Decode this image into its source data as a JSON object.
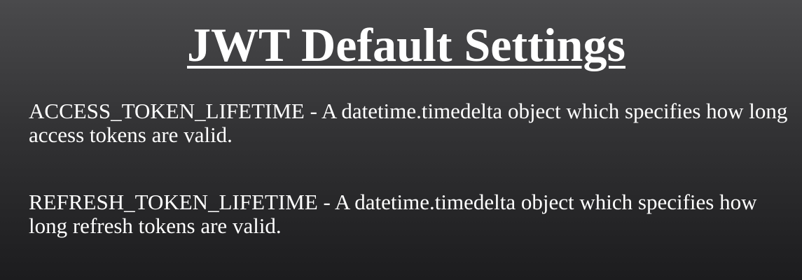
{
  "slide": {
    "title": "JWT Default Settings",
    "paragraphs": [
      {
        "text": "ACCESS_TOKEN_LIFETIME - A datetime.timedelta object which specifies how long access tokens are valid."
      },
      {
        "text": "REFRESH_TOKEN_LIFETIME - A datetime.timedelta object which specifies how long refresh tokens are valid."
      }
    ]
  },
  "colors": {
    "background_top": "#4a4a4c",
    "background_bottom": "#1c1c1e",
    "text": "#ffffff"
  }
}
